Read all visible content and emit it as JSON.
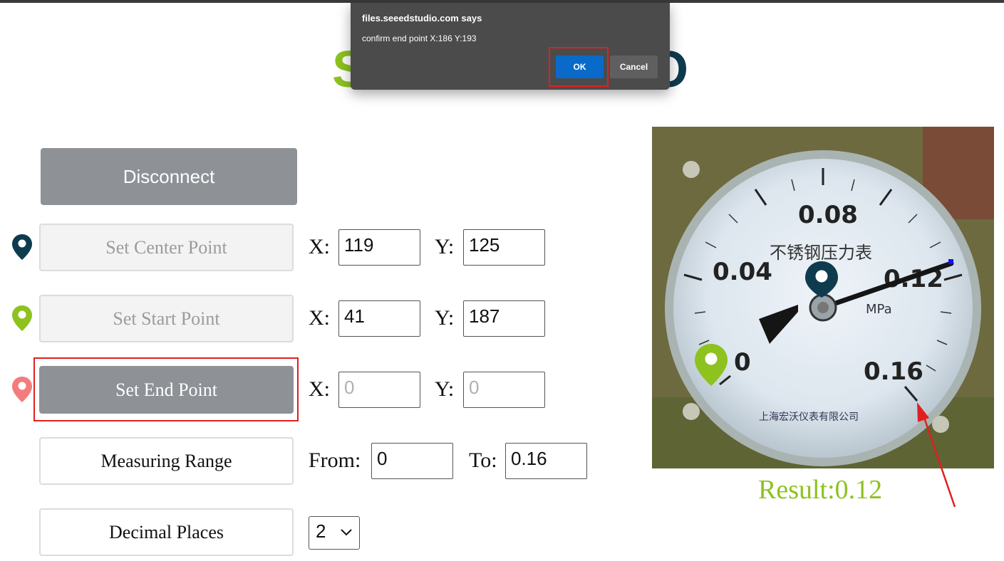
{
  "dialog": {
    "title": "files.seeedstudio.com says",
    "message": "confirm end point X:186 Y:193",
    "ok_label": "OK",
    "cancel_label": "Cancel"
  },
  "logo": {
    "left_text": "S",
    "right_text": "O"
  },
  "controls": {
    "disconnect_label": "Disconnect",
    "center": {
      "label": "Set Center Point",
      "x": "119",
      "y": "125"
    },
    "start": {
      "label": "Set Start Point",
      "x": "41",
      "y": "187"
    },
    "end": {
      "label": "Set End Point",
      "x_placeholder": "0",
      "y_placeholder": "0"
    },
    "range": {
      "label": "Measuring Range",
      "from_label": "From:",
      "to_label": "To:",
      "from": "0",
      "to": "0.16"
    },
    "decimal": {
      "label": "Decimal Places",
      "value": "2"
    },
    "x_label": "X:",
    "y_label": "Y:"
  },
  "gauge": {
    "scale_labels": [
      "0",
      "0.04",
      "0.08",
      "0.12",
      "0.16"
    ],
    "unit": "MPa",
    "face_text": "不锈钢压力表",
    "maker_text": "上海宏沃仪表有限公司"
  },
  "result": "Result:0.12",
  "colors": {
    "accent_green": "#8dc21f",
    "dark_teal": "#0e3b4e",
    "pin_red": "#f47c7c",
    "button_gray": "#8e9196",
    "ok_blue": "#0a6ac9",
    "highlight_red": "#e02020"
  }
}
